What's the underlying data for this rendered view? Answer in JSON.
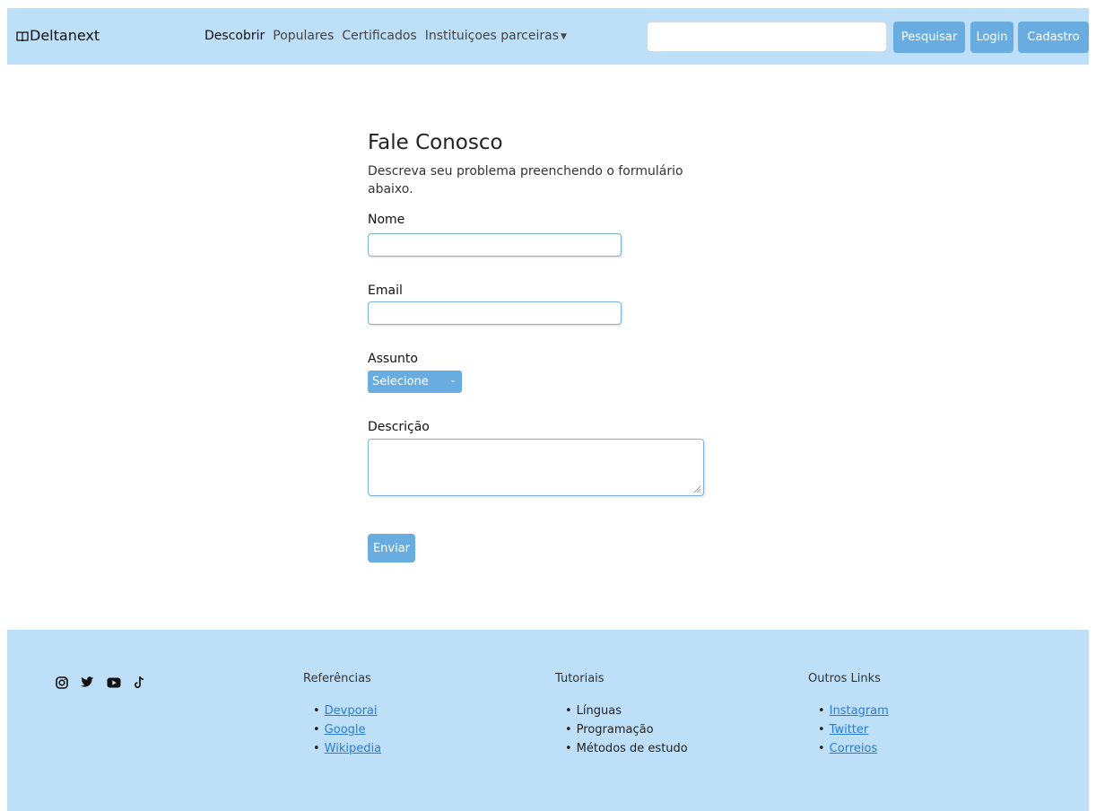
{
  "navbar": {
    "brand": "Deltanext",
    "links": [
      {
        "label": "Descobrir"
      },
      {
        "label": "Populares"
      },
      {
        "label": "Certificados"
      },
      {
        "label": "Instituiçoes parceiras"
      }
    ],
    "search_placeholder": "",
    "search_button": "Pesquisar",
    "login_button": "Login",
    "signup_button": "Cadastro"
  },
  "form": {
    "title": "Fale Conosco",
    "description": "Descreva seu problema preenchendo o formulário abaixo.",
    "name_label": "Nome",
    "name_value": "",
    "email_label": "Email",
    "email_value": "",
    "subject_label": "Assunto",
    "subject_selected": "Selecione",
    "description_label": "Descrição",
    "description_value": "",
    "submit_label": "Enviar"
  },
  "footer": {
    "social_icons": [
      "instagram-icon",
      "twitter-icon",
      "youtube-icon",
      "tiktok-icon"
    ],
    "columns": [
      {
        "title": "Referências",
        "items": [
          "Devporai",
          "Google",
          "Wikipedia"
        ]
      },
      {
        "title": "Tutoriais",
        "items": [
          "Línguas",
          "Programação",
          "Métodos de estudo"
        ]
      },
      {
        "title": "Outros Links",
        "items": [
          "Instagram",
          "Twitter",
          "Correios"
        ]
      }
    ]
  },
  "colors": {
    "navbar_bg": "#bde0f8",
    "button_bg": "#69ade0",
    "link_color": "#2a7bd3"
  }
}
